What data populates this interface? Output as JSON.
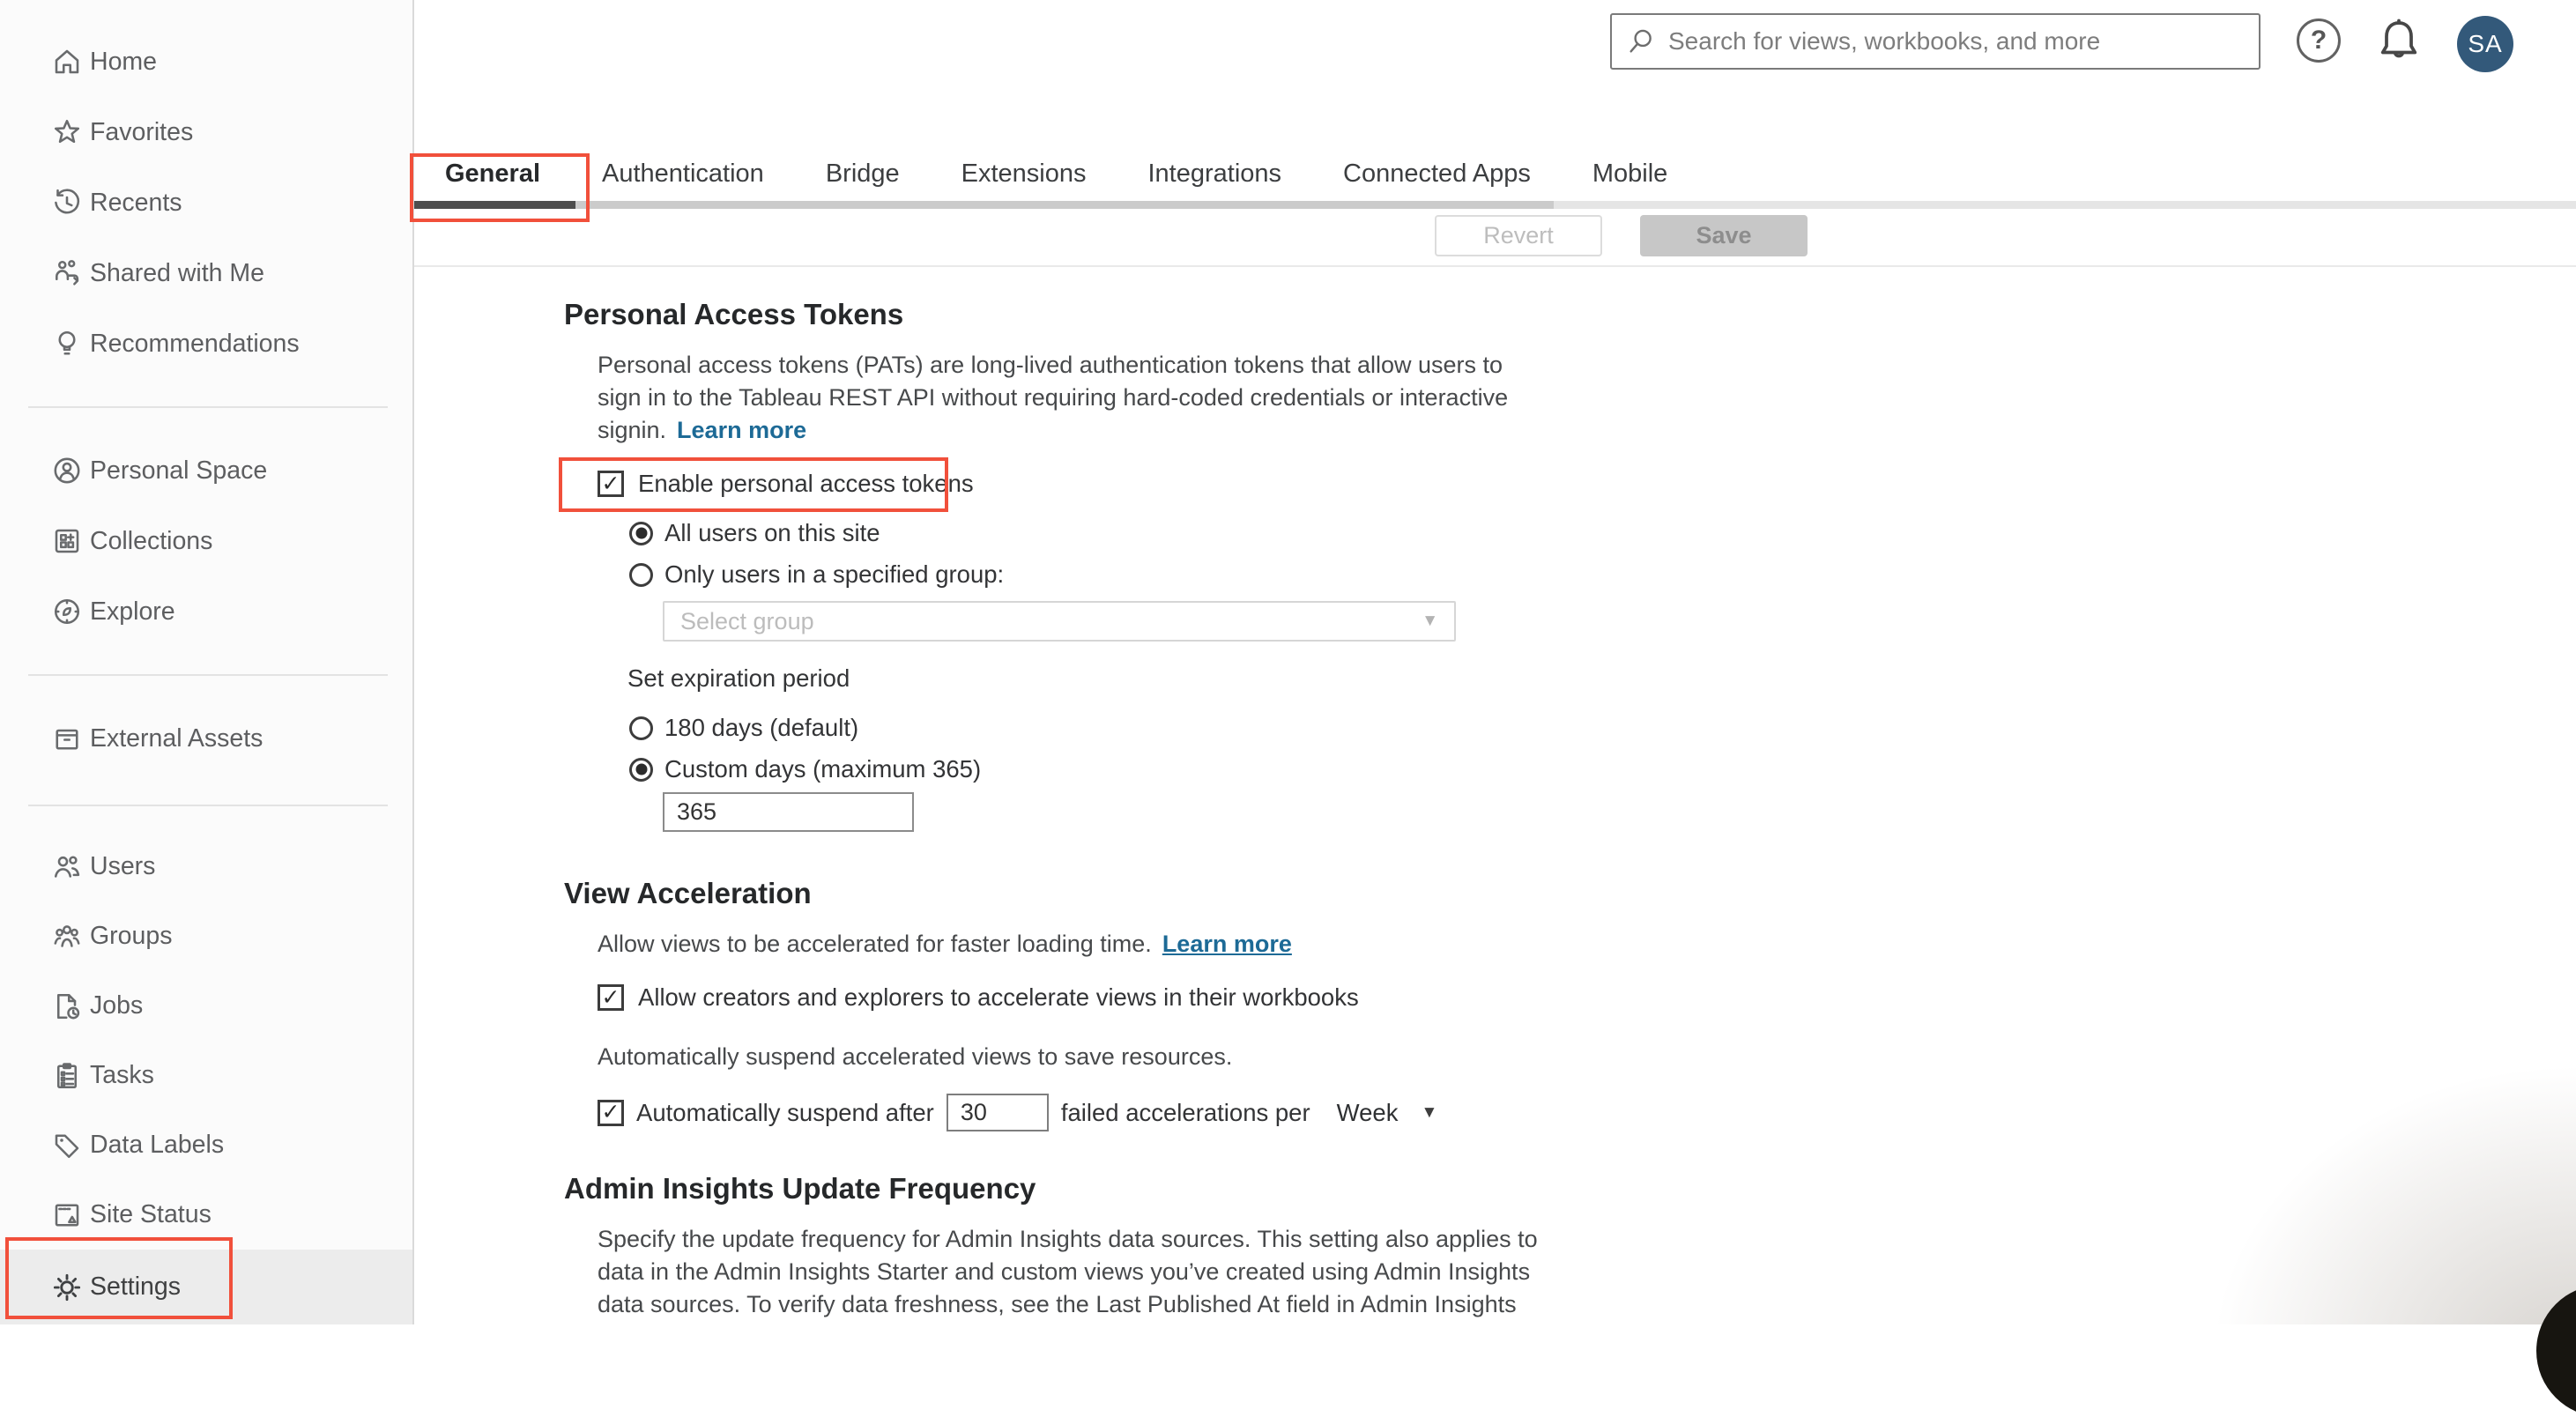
{
  "topbar": {
    "search_placeholder": "Search for views, workbooks, and more",
    "avatar_initials": "SA"
  },
  "sidebar": {
    "items": [
      {
        "label": "Home",
        "icon": "home-icon"
      },
      {
        "label": "Favorites",
        "icon": "star-icon"
      },
      {
        "label": "Recents",
        "icon": "history-icon"
      },
      {
        "label": "Shared with Me",
        "icon": "shared-with-me-icon"
      },
      {
        "label": "Recommendations",
        "icon": "lightbulb-icon"
      },
      {
        "label": "Personal Space",
        "icon": "person-circle-icon"
      },
      {
        "label": "Collections",
        "icon": "collections-icon"
      },
      {
        "label": "Explore",
        "icon": "compass-icon"
      },
      {
        "label": "External Assets",
        "icon": "archive-icon"
      },
      {
        "label": "Users",
        "icon": "users-icon"
      },
      {
        "label": "Groups",
        "icon": "groups-icon"
      },
      {
        "label": "Jobs",
        "icon": "file-clock-icon"
      },
      {
        "label": "Tasks",
        "icon": "clipboard-icon"
      },
      {
        "label": "Data Labels",
        "icon": "tag-icon"
      },
      {
        "label": "Site Status",
        "icon": "browser-alert-icon"
      },
      {
        "label": "Settings",
        "icon": "gear-icon",
        "selected": true
      }
    ]
  },
  "tabs": {
    "items": [
      {
        "label": "General",
        "active": true
      },
      {
        "label": "Authentication"
      },
      {
        "label": "Bridge"
      },
      {
        "label": "Extensions"
      },
      {
        "label": "Integrations"
      },
      {
        "label": "Connected Apps"
      },
      {
        "label": "Mobile"
      }
    ]
  },
  "toolbar": {
    "revert_label": "Revert",
    "save_label": "Save"
  },
  "pat": {
    "title": "Personal Access Tokens",
    "description_lines": [
      "Personal access tokens (PATs) are long-lived authentication tokens that allow users to",
      "sign in to the Tableau REST API without requiring hard-coded credentials or interactive",
      "signin."
    ],
    "learn_more": "Learn more",
    "enable_label": "Enable personal access tokens",
    "radio_all_users": "All users on this site",
    "radio_specified_group": "Only users in a specified group:",
    "group_placeholder": "Select group",
    "expiration_label": "Set expiration period",
    "radio_default_days": "180 days (default)",
    "radio_custom_days": "Custom days (maximum 365)",
    "custom_days_value": "365"
  },
  "view_acceleration": {
    "title": "View Acceleration",
    "description": "Allow views to be accelerated for faster loading time.",
    "learn_more": "Learn more",
    "allow_label": "Allow creators and explorers to accelerate views in their workbooks",
    "suspend_description": "Automatically suspend accelerated views to save resources.",
    "suspend_prefix": "Automatically suspend after",
    "suspend_value": "30",
    "suspend_suffix": "failed accelerations per",
    "period_value": "Week"
  },
  "admin_insights": {
    "title": "Admin Insights Update Frequency",
    "description_lines": [
      "Specify the update frequency for Admin Insights data sources. This setting also applies to",
      "data in the Admin Insights Starter and custom views you’ve created using Admin Insights",
      "data sources. To verify data freshness, see the Last Published At field in Admin Insights"
    ]
  },
  "colors": {
    "annotation_red": "#f1503b",
    "link_blue": "#1d6a96",
    "avatar_bg": "#33597a",
    "active_tab_indicator": "#4e4e4e"
  }
}
